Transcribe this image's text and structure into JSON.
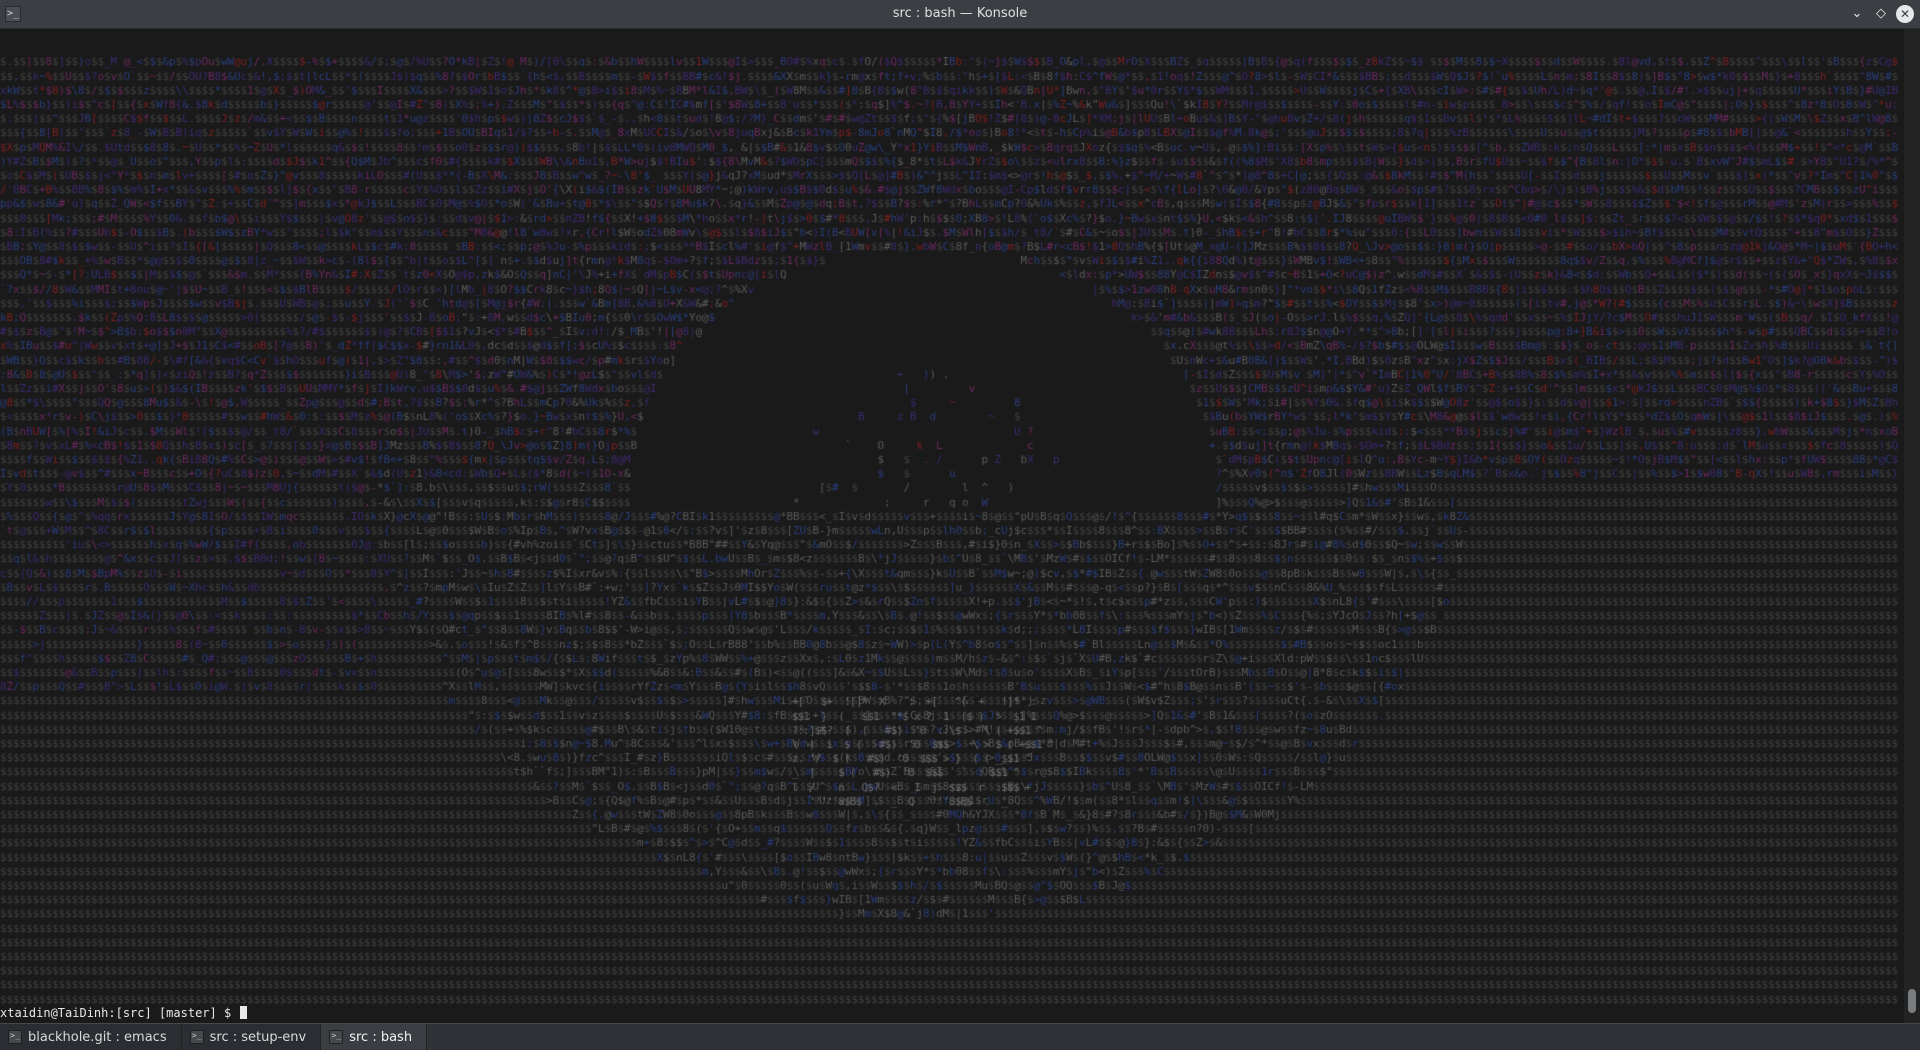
{
  "window": {
    "title": "src : bash — Konsole",
    "app_icon": "terminal-icon",
    "app_icon_glyph": ">_",
    "controls": [
      {
        "name": "minimize-button",
        "icon": "chevron-down-icon",
        "glyph": "⌄"
      },
      {
        "name": "maximize-button",
        "icon": "diamond-icon",
        "glyph": "◇"
      },
      {
        "name": "close-button",
        "icon": "close-icon",
        "glyph": "✕"
      }
    ]
  },
  "terminal": {
    "prompt": "xtaidin@TaiDinh:[src] [master] $ ",
    "colors": {
      "background": "#1a1a1a",
      "dim_text": "#404040",
      "purple": "#3c2a6e",
      "blue": "#2a3e7a",
      "magenta": "#6a2a5e",
      "red": "#7a2020",
      "light_text": "#e8e8e8"
    }
  },
  "tabs": [
    {
      "label": "blackhole.git : emacs",
      "icon": "terminal-icon",
      "active": false
    },
    {
      "label": "src : setup-env",
      "icon": "terminal-icon",
      "active": false
    },
    {
      "label": "src : bash",
      "icon": "terminal-icon",
      "active": true
    }
  ]
}
